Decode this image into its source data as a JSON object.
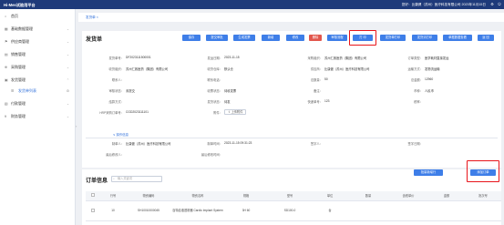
{
  "app": {
    "title": "Hi-Mes试验用平台"
  },
  "user": {
    "info": "您好：比康健（苏州）医疗科技有限公司   2023年11月15日"
  },
  "sidebar": {
    "items": [
      {
        "label": "首页"
      },
      {
        "label": "基础数据管理"
      },
      {
        "label": "供应商管理"
      },
      {
        "label": "销售管理"
      },
      {
        "label": "采购管理"
      },
      {
        "label": "发货管理"
      },
      {
        "label": "发货单列表"
      },
      {
        "label": "付款管理"
      },
      {
        "label": "财务管理"
      }
    ]
  },
  "tabs": [
    {
      "label": "发货单 ×"
    }
  ],
  "page": {
    "title": "发货单"
  },
  "toolbar": {
    "buttons": [
      {
        "label": "保存"
      },
      {
        "label": "提交审批"
      },
      {
        "label": "生成发票"
      },
      {
        "label": "新增"
      },
      {
        "label": "修改"
      },
      {
        "label": "删除"
      },
      {
        "label": "审核流程"
      },
      {
        "label": "打 印"
      },
      {
        "label": "发货单打印"
      },
      {
        "label": "发货清打印"
      },
      {
        "label": "单据数据查看"
      },
      {
        "label": "返 回"
      }
    ]
  },
  "form": {
    "fields": [
      {
        "label": "发货单号：",
        "value": "DF2023111500001"
      },
      {
        "label": "发运日期：",
        "value": "2023-11-15"
      },
      {
        "label": "采购组织：",
        "value": "苏州仁致医药（集团）有限公司"
      },
      {
        "label": "订单类型：",
        "value": "医学耗材直接发运"
      },
      {
        "label": "收货组织：",
        "value": "苏州仁致医药（集团）有限公司"
      },
      {
        "label": "收货仓库：",
        "value": "默认仓"
      },
      {
        "label": "供应商：",
        "value": "比康健（苏州）医疗科技有限公司"
      },
      {
        "label": "运输方式：",
        "value": "发物流运输"
      },
      {
        "label": "联系人：",
        "value": ""
      },
      {
        "label": "联系电话：",
        "value": ""
      },
      {
        "label": "总数量：",
        "value": "50"
      },
      {
        "label": "总金额：",
        "value": "12960"
      },
      {
        "label": "审核状态：",
        "value": "未提交"
      },
      {
        "label": "收票状态：",
        "value": "待收发票"
      },
      {
        "label": "备注：",
        "value": ""
      },
      {
        "label": "币种：",
        "value": "人民币"
      },
      {
        "label": "结算方式：",
        "value": ""
      },
      {
        "label": "发货状态：",
        "value": "待发"
      },
      {
        "label": "快递单号：",
        "value": "123"
      },
      {
        "label": "税率：",
        "value": ""
      },
      {
        "label": "HRP采购订单号：",
        "value": "CGD2023111101"
      },
      {
        "label": "附件：",
        "value": ""
      }
    ],
    "upload_label": "上传附件",
    "more_info": "∨ 操作信息",
    "operation": [
      {
        "label": "制单人：",
        "value": "比康健（苏州）医疗科技有限公司"
      },
      {
        "label": "制单时间：",
        "value": "2023-11-15 09:31:23"
      },
      {
        "label": "签字人：",
        "value": ""
      },
      {
        "label": "签字日期：",
        "value": ""
      },
      {
        "label": "最后修改人：",
        "value": ""
      },
      {
        "label": "最后修改时间：",
        "value": ""
      }
    ]
  },
  "order_info": {
    "title": "订单信息",
    "search_placeholder": "输入关键词",
    "buttons": [
      {
        "label": "批量新增行"
      },
      {
        "label": "添加订单"
      }
    ],
    "columns": [
      "",
      "行号",
      "物资编码",
      "物资名称",
      "规格",
      "型号",
      "单位",
      "数量",
      "含税单价",
      "金额",
      "批次号"
    ],
    "rows": [
      {
        "cells": [
          "",
          "10",
          "SH10010000045",
          "百特血液透析器 Cardio Implant System",
          "3H 60",
          "SD100-0",
          "台",
          "",
          "",
          "",
          ""
        ]
      }
    ]
  }
}
